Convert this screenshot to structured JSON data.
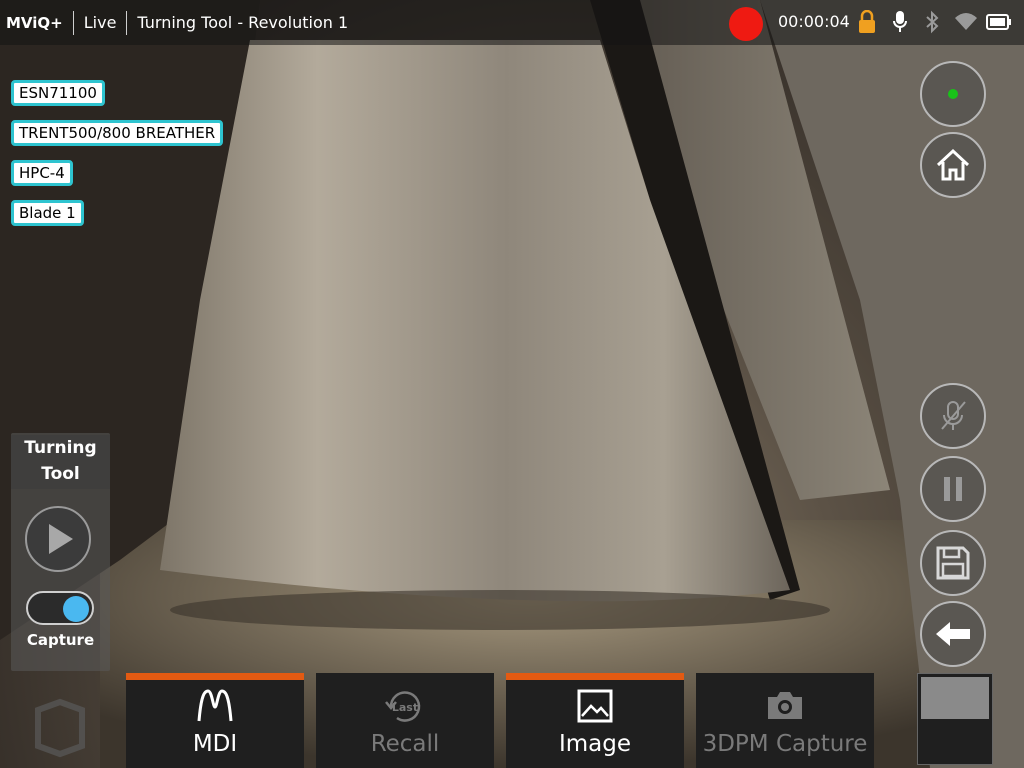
{
  "topbar": {
    "brand": "MViQ+",
    "mode": "Live",
    "title": "Turning Tool - Revolution 1",
    "timer": "00:00:04",
    "recording_color": "#ef1a12",
    "icons": [
      "lock-icon",
      "microphone-icon",
      "bluetooth-icon",
      "wifi-icon",
      "battery-icon"
    ]
  },
  "tags": [
    "ESN71100",
    "TRENT500/800 BREATHER",
    "HPC-4",
    "Blade 1"
  ],
  "left_panel": {
    "title_line1": "Turning",
    "title_line2": "Tool",
    "capture_label": "Capture"
  },
  "right_buttons": [
    "joystick-status-icon",
    "home-icon",
    "mute-mic-icon",
    "pause-icon",
    "save-icon",
    "back-arrow-icon"
  ],
  "softkeys": [
    {
      "label": "MDI",
      "icon": "mdi-icon",
      "active": true
    },
    {
      "label": "Recall",
      "icon": "last-recall-icon",
      "badge": "Last",
      "active": false,
      "disabled": true
    },
    {
      "label": "Image",
      "icon": "image-icon",
      "active": true
    },
    {
      "label": "3DPM Capture",
      "icon": "camera-icon",
      "active": false,
      "disabled": true
    }
  ],
  "colors": {
    "accent": "#e35a12",
    "tag_border": "#2ec4d0",
    "toggle_on": "#4ab8f0",
    "status_green": "#19c219",
    "lock": "#f0a020"
  }
}
